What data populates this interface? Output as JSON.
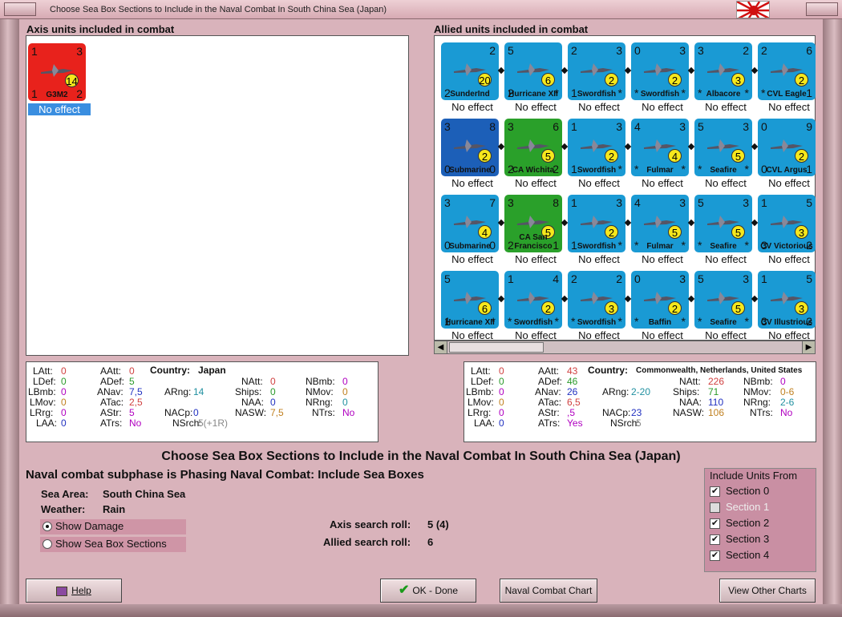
{
  "window": {
    "title": "Choose Sea Box Sections to Include in the Naval Combat In South China Sea (Japan)"
  },
  "axis": {
    "header": "Axis units included in combat",
    "units": [
      {
        "tl": "1",
        "tr": "3",
        "bl": "1",
        "br": "2",
        "name": "G3M2",
        "circle": "14",
        "effect": "No effect",
        "color": "#e8221c"
      }
    ]
  },
  "allied": {
    "header": "Allied units included in combat",
    "units": [
      {
        "tl": "",
        "tr": "2",
        "bl": "2",
        "br": "",
        "name": "SunderInd",
        "circle": "20",
        "effect": "No effect",
        "color": "#1a9ad4"
      },
      {
        "tl": "5",
        "tr": "",
        "bl": "2",
        "br": "*",
        "name": "Hurricane XII",
        "circle": "6",
        "effect": "No effect",
        "color": "#1a9ad4"
      },
      {
        "tl": "2",
        "tr": "3",
        "bl": "1",
        "br": "*",
        "name": "Swordfish",
        "circle": "2",
        "effect": "No effect",
        "color": "#1a9ad4"
      },
      {
        "tl": "0",
        "tr": "3",
        "bl": "*",
        "br": "*",
        "name": "Swordfish",
        "circle": "2",
        "effect": "No effect",
        "color": "#1a9ad4"
      },
      {
        "tl": "3",
        "tr": "2",
        "bl": "*",
        "br": "*",
        "name": "Albacore",
        "circle": "3",
        "effect": "No effect",
        "color": "#1a9ad4"
      },
      {
        "tl": "2",
        "tr": "6",
        "bl": "*",
        "br": "1",
        "name": "CVL Eagle",
        "circle": "2",
        "effect": "No effect",
        "color": "#1a9ad4"
      },
      {
        "tl": "3",
        "tr": "8",
        "bl": "0",
        "br": "0",
        "name": "Submarine",
        "circle": "2",
        "effect": "No effect",
        "color": "#1c5fb8"
      },
      {
        "tl": "3",
        "tr": "6",
        "bl": "2",
        "br": "2",
        "name": "CA Wichita",
        "circle": "5",
        "effect": "No effect",
        "color": "#2aa02a"
      },
      {
        "tl": "1",
        "tr": "3",
        "bl": "1",
        "br": "*",
        "name": "Swordfish",
        "circle": "2",
        "effect": "No effect",
        "color": "#1a9ad4"
      },
      {
        "tl": "4",
        "tr": "3",
        "bl": "*",
        "br": "*",
        "name": "Fulmar",
        "circle": "4",
        "effect": "No effect",
        "color": "#1a9ad4"
      },
      {
        "tl": "5",
        "tr": "3",
        "bl": "*",
        "br": "*",
        "name": "Seafire",
        "circle": "5",
        "effect": "No effect",
        "color": "#1a9ad4"
      },
      {
        "tl": "0",
        "tr": "9",
        "bl": "0",
        "br": "1",
        "name": "CVL Argus",
        "circle": "2",
        "effect": "No effect",
        "color": "#1a9ad4"
      },
      {
        "tl": "3",
        "tr": "7",
        "bl": "0",
        "br": "0",
        "name": "Submarine",
        "circle": "4",
        "effect": "No effect",
        "color": "#1a9ad4"
      },
      {
        "tl": "3",
        "tr": "8",
        "bl": "2",
        "br": "1",
        "name": "CA San Francisco",
        "circle": "5",
        "effect": "No effect",
        "color": "#2aa02a"
      },
      {
        "tl": "1",
        "tr": "3",
        "bl": "1",
        "br": "*",
        "name": "Swordfish",
        "circle": "2",
        "effect": "No effect",
        "color": "#1a9ad4"
      },
      {
        "tl": "4",
        "tr": "3",
        "bl": "*",
        "br": "*",
        "name": "Fulmar",
        "circle": "5",
        "effect": "No effect",
        "color": "#1a9ad4"
      },
      {
        "tl": "5",
        "tr": "3",
        "bl": "*",
        "br": "*",
        "name": "Seafire",
        "circle": "5",
        "effect": "No effect",
        "color": "#1a9ad4"
      },
      {
        "tl": "1",
        "tr": "5",
        "bl": "3",
        "br": "2",
        "name": "CV Victorious",
        "circle": "3",
        "effect": "No effect",
        "color": "#1a9ad4"
      },
      {
        "tl": "5",
        "tr": "",
        "bl": "1",
        "br": "*",
        "name": "Hurricane XII",
        "circle": "6",
        "effect": "No effect",
        "color": "#1a9ad4"
      },
      {
        "tl": "1",
        "tr": "4",
        "bl": "*",
        "br": "*",
        "name": "Swordfish",
        "circle": "2",
        "effect": "No effect",
        "color": "#1a9ad4"
      },
      {
        "tl": "2",
        "tr": "2",
        "bl": "*",
        "br": "*",
        "name": "Swordfish",
        "circle": "3",
        "effect": "No effect",
        "color": "#1a9ad4"
      },
      {
        "tl": "0",
        "tr": "3",
        "bl": "*",
        "br": "*",
        "name": "Baffin",
        "circle": "2",
        "effect": "No effect",
        "color": "#1a9ad4"
      },
      {
        "tl": "5",
        "tr": "3",
        "bl": "*",
        "br": "*",
        "name": "Seafire",
        "circle": "5",
        "effect": "No effect",
        "color": "#1a9ad4"
      },
      {
        "tl": "1",
        "tr": "5",
        "bl": "3",
        "br": "2",
        "name": "CV Illustrious",
        "circle": "3",
        "effect": "No effect",
        "color": "#1a9ad4"
      }
    ]
  },
  "axis_stats": {
    "latt": "0",
    "aatt": "0",
    "country_label": "Country:",
    "country": "Japan",
    "ldef": "0",
    "adef": "5",
    "natt": "0",
    "nbmb": "0",
    "lbmb": "0",
    "anav": "7,5",
    "arng": "14",
    "ships": "0",
    "nmov": "0",
    "lmov": "0",
    "atac": "2,5",
    "naa": "0",
    "nrng": "0",
    "lrng": "0",
    "astr": "5",
    "nacp": "0",
    "nasw": "7,5",
    "ntrs": "No",
    "laa": "0",
    "atrs": "No",
    "nsrch": "5(+1R)"
  },
  "allied_stats": {
    "latt": "0",
    "aatt": "43",
    "country_label": "Country:",
    "country": "Commonwealth, Netherlands, United States",
    "ldef": "0",
    "adef": "46",
    "natt": "226",
    "nbmb": "0",
    "lbmb": "0",
    "anav": "26",
    "arng": "2-20",
    "ships": "71",
    "nmov": "0-6",
    "lmov": "0",
    "atac": "6,5",
    "naa": "110",
    "nrng": "2-6",
    "lrng": "0",
    "astr": ",5",
    "nacp": "23",
    "nasw": "106",
    "ntrs": "No",
    "laa": "0",
    "atrs": "Yes",
    "nsrch": "5"
  },
  "labels": {
    "latt": "LAtt:",
    "aatt": "AAtt:",
    "ldef": "LDef:",
    "adef": "ADef:",
    "natt": "NAtt:",
    "nbmb": "NBmb:",
    "lbmb": "LBmb:",
    "anav": "ANav:",
    "arng": "ARng:",
    "ships": "Ships:",
    "nmov": "NMov:",
    "lmov": "LMov:",
    "atac": "ATac:",
    "naa": "NAA:",
    "nrng": "NRng:",
    "lrng": "LRrg:",
    "astr": "AStr:",
    "nacp": "NACp:",
    "nasw": "NASW:",
    "ntrs": "NTrs:",
    "laa": "LAA:",
    "atrs": "ATrs:",
    "nsrch": "NSrch:"
  },
  "main": {
    "title": "Choose Sea Box Sections to Include in the Naval Combat In South China Sea (Japan)",
    "subphase": "Naval combat subphase is Phasing Naval Combat: Include Sea Boxes",
    "sea_area_label": "Sea Area:",
    "sea_area": "South China Sea",
    "weather_label": "Weather:",
    "weather": "Rain",
    "show_damage": "Show Damage",
    "show_sections": "Show Sea Box Sections",
    "axis_roll_label": "Axis search roll:",
    "axis_roll": "5 (4)",
    "allied_roll_label": "Allied search roll:",
    "allied_roll": "6"
  },
  "include": {
    "title": "Include Units From",
    "sections": [
      {
        "label": "Section 0",
        "checked": true
      },
      {
        "label": "Section 1",
        "checked": false
      },
      {
        "label": "Section 2",
        "checked": true
      },
      {
        "label": "Section 3",
        "checked": true
      },
      {
        "label": "Section 4",
        "checked": true
      }
    ]
  },
  "buttons": {
    "help": "Help",
    "ok": "OK - Done",
    "naval_chart": "Naval Combat Chart",
    "other_charts": "View Other Charts"
  }
}
